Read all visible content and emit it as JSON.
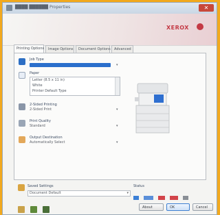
{
  "window": {
    "title": "████ ██████ Properties",
    "close_glyph": "✕"
  },
  "banner": {
    "brand": "XEROX"
  },
  "tabs": [
    {
      "label": "Printing Options"
    },
    {
      "label": "Image Options"
    },
    {
      "label": "Document Options"
    },
    {
      "label": "Advanced"
    }
  ],
  "sections": {
    "job_type": {
      "label": "Job Type",
      "icon": "job-type-icon",
      "arrow": "▾"
    },
    "paper": {
      "label": "Paper",
      "lines": [
        "Letter (8.5 x 11 in)",
        "White",
        "Printer Default Type"
      ],
      "icon": "paper-icon"
    },
    "two_sided": {
      "label": "2-Sided Printing",
      "value": "2-Sided Print",
      "icon": "two-sided-icon",
      "arrow": "▾"
    },
    "print_quality": {
      "label": "Print Quality",
      "value": "Standard",
      "icon": "print-quality-icon",
      "arrow": "▾"
    },
    "output_destination": {
      "label": "Output Destination",
      "value": "Automatically Select",
      "icon": "output-destination-icon",
      "arrow": "▾"
    }
  },
  "saved_settings": {
    "label": "Saved Settings",
    "value": "Document Default",
    "caret": "▾"
  },
  "status": {
    "label": "Status"
  },
  "buttons": {
    "about": "About",
    "ok": "OK",
    "cancel": "Cancel"
  },
  "colors": {
    "background": "#f2a91e",
    "accent": "#2b6fcc",
    "brand": "#c43a45"
  }
}
